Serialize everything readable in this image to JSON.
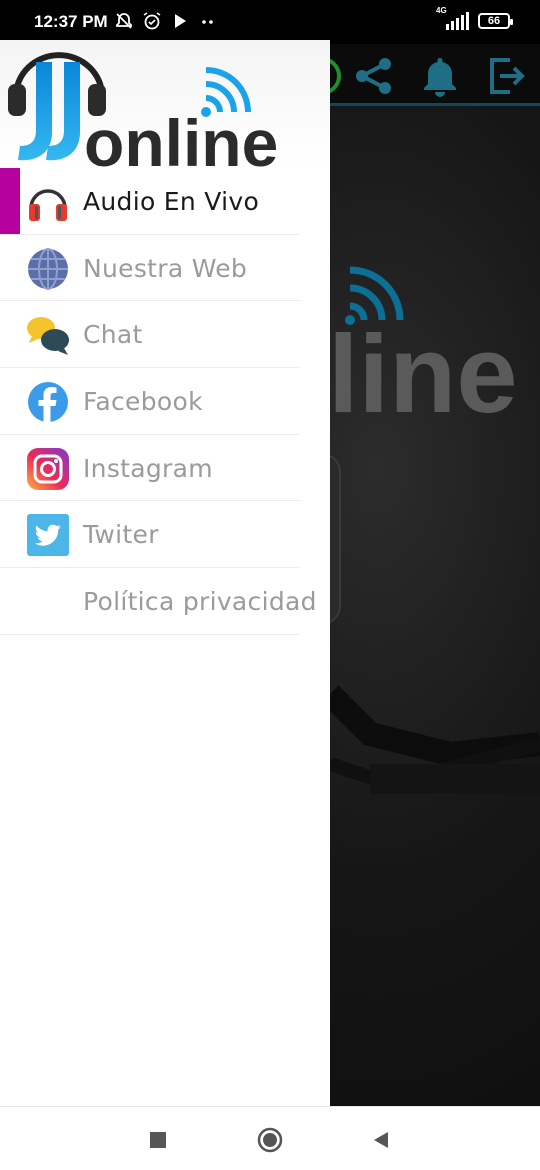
{
  "status_bar": {
    "time": "12:37 PM",
    "network": "4G",
    "battery": "66"
  },
  "drawer": {
    "logo_text": "online",
    "items": [
      {
        "label": "Audio En Vivo",
        "icon": "headphones-icon",
        "active": true
      },
      {
        "label": "Nuestra Web",
        "icon": "globe-icon",
        "active": false
      },
      {
        "label": "Chat",
        "icon": "chat-bubbles-icon",
        "active": false
      },
      {
        "label": "Facebook",
        "icon": "facebook-icon",
        "active": false
      },
      {
        "label": "Instagram",
        "icon": "instagram-icon",
        "active": false
      },
      {
        "label": "Twiter",
        "icon": "twitter-icon",
        "active": false
      },
      {
        "label": "Política privacidad",
        "icon": "",
        "active": false
      }
    ]
  },
  "app": {
    "background_logo_text": "line"
  },
  "colors": {
    "accent_active": "#b5009e",
    "brand_blue": "#1aa3e8",
    "toolbar_icon": "#1f6e85"
  }
}
